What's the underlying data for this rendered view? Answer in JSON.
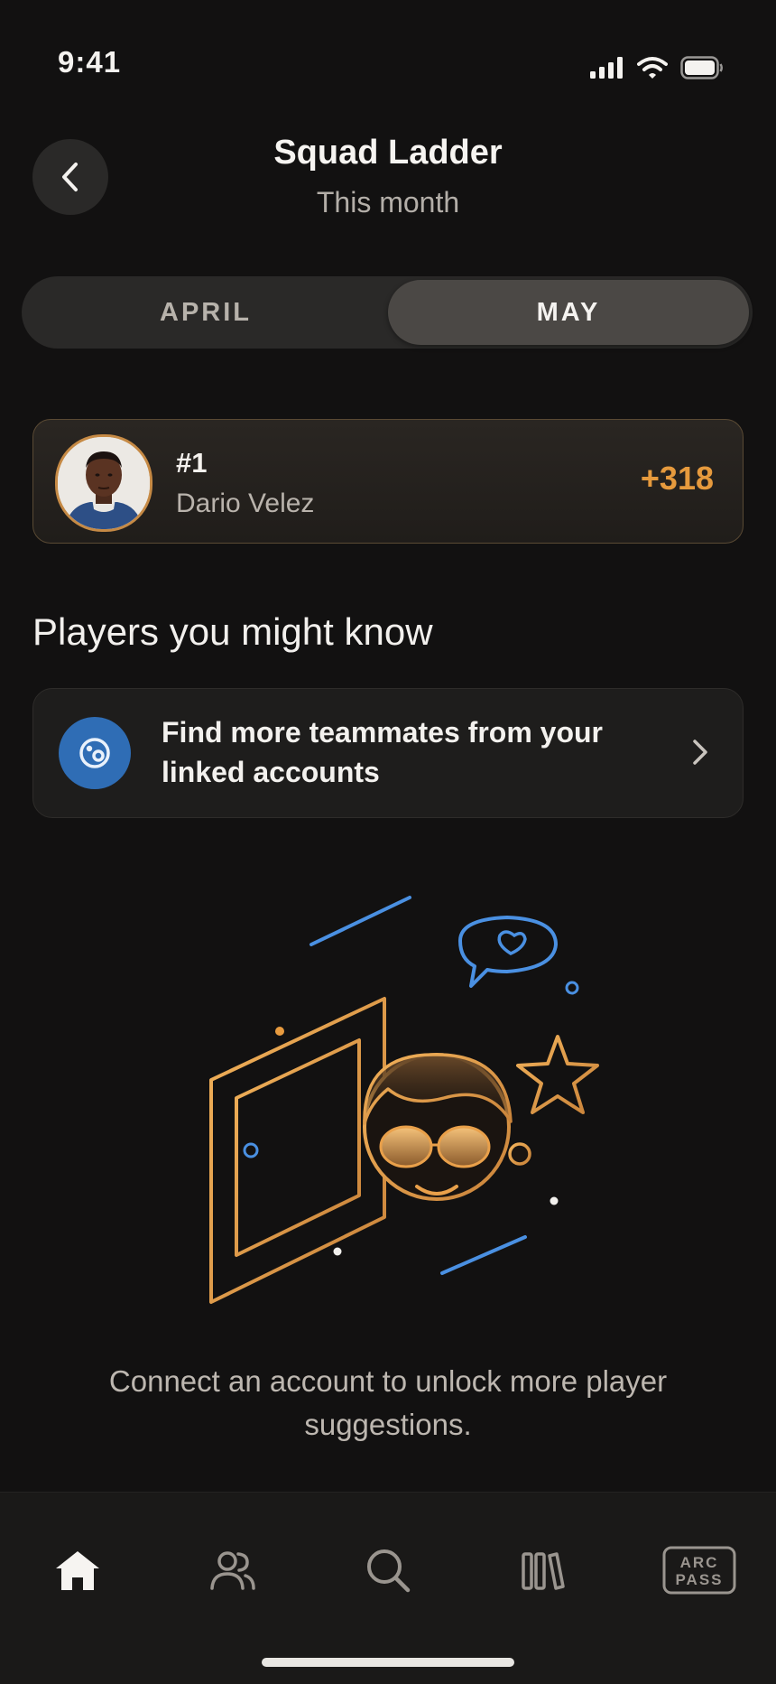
{
  "status_bar": {
    "time": "9:41"
  },
  "header": {
    "title": "Squad Ladder",
    "subtitle": "This month"
  },
  "month_tabs": [
    {
      "label": "APRIL",
      "selected": false
    },
    {
      "label": "MAY",
      "selected": true
    }
  ],
  "leader": {
    "rank": "#1",
    "name": "Dario Velez",
    "score": "+318"
  },
  "suggestions": {
    "section_title": "Players you might know",
    "find_card_text": "Find more teammates from your linked accounts",
    "empty_text": "Connect an account to unlock more player suggestions."
  },
  "tab_bar": {
    "items": [
      {
        "icon": "home-icon",
        "active": true
      },
      {
        "icon": "people-icon",
        "active": false
      },
      {
        "icon": "search-icon",
        "active": false
      },
      {
        "icon": "library-icon",
        "active": false
      },
      {
        "icon": "arc-pass-icon",
        "active": false,
        "label_line1": "ARC",
        "label_line2": "PASS"
      }
    ]
  },
  "colors": {
    "background": "#121111",
    "accent": "#e69a3d",
    "blue": "#2f6db5",
    "text_secondary": "#b3aea8"
  }
}
